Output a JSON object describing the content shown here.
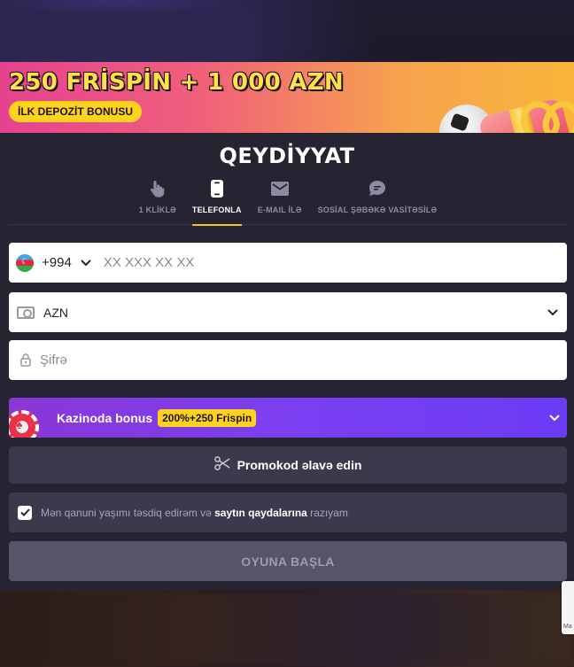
{
  "banner": {
    "title": "250 FRİSPİN + 1 000  AZN",
    "badge": "İLK DEPOZİT BONUSU"
  },
  "form": {
    "title": "QEYDİYYAT",
    "tabs": [
      {
        "label": "1 KLİKLƏ",
        "icon": "hand-pointer-icon",
        "active": false
      },
      {
        "label": "TELEFONLA",
        "icon": "phone-icon",
        "active": true
      },
      {
        "label": "E-MAIL İLƏ",
        "icon": "envelope-icon",
        "active": false
      },
      {
        "label": "SOSİAL ŞƏBƏKƏ VASİTƏSİLƏ",
        "icon": "chat-bubble-icon",
        "active": false
      }
    ],
    "phone": {
      "country_code": "+994",
      "placeholder": "XX XXX XX XX",
      "value": ""
    },
    "currency": {
      "value": "AZN"
    },
    "password": {
      "placeholder": "Şifrə"
    },
    "bonus": {
      "label": "Kazinoda bonus",
      "tag": "200%+250 Frispin"
    },
    "promo": {
      "label": "Promokod əlavə edin"
    },
    "agreement": {
      "prefix": "Mən qanuni yaşımı təsdiq edirəm və",
      "link": "saytın qaydalarına",
      "suffix": "razıyam",
      "checked": true
    },
    "submit_label": "OYUNA BAŞLA"
  },
  "recaptcha": {
    "label": "Ma"
  },
  "colors": {
    "accent_yellow": "#f5c527",
    "panel_bg": "#262433",
    "bonus_purple": "#7b3ff0",
    "banner_pink": "#e6428f",
    "banner_orange": "#f8b53a"
  }
}
